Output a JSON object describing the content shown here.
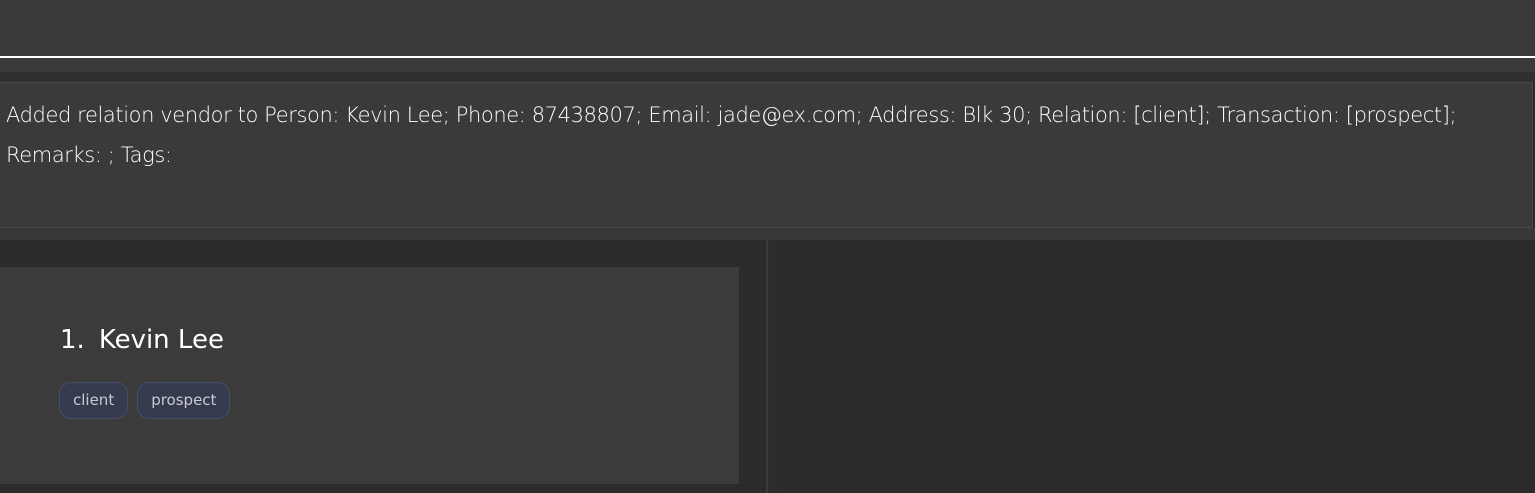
{
  "command_box": {
    "value": "",
    "placeholder": ""
  },
  "result_display": {
    "message": "Added relation vendor to Person: Kevin Lee; Phone: 87438807; Email: jade@ex.com; Address: Blk 30; Relation: [client]; Transaction: [prospect]; Remarks: ; Tags:"
  },
  "person_list": {
    "items": [
      {
        "index": "1.",
        "name": "Kevin Lee",
        "tags": [
          "client",
          "prospect"
        ]
      }
    ]
  },
  "colors": {
    "background": "#2b2b2b",
    "panel": "#3a3a3a",
    "card": "#3b3b3b",
    "tag_background": "#363a4e",
    "tag_border": "#474d66",
    "text": "#ffffff"
  }
}
